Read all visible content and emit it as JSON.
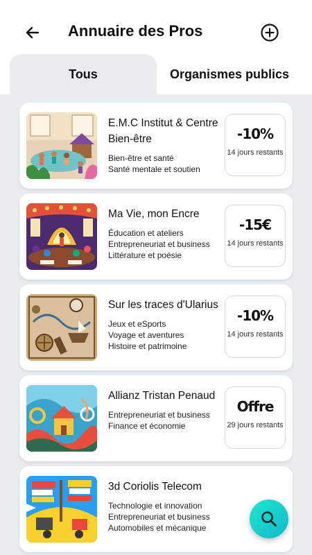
{
  "header": {
    "title": "Annuaire des Pros",
    "back_icon": "arrow-left-icon",
    "add_icon": "plus-circle-icon"
  },
  "tabs": [
    {
      "label": "Tous",
      "selected": true
    },
    {
      "label": "Organismes publics",
      "selected": false
    }
  ],
  "pros": [
    {
      "name": "E.M.C Institut & Centre Bien-être",
      "categories": [
        "Bien-être et santé",
        "Santé mentale et soutien"
      ],
      "offer": "-10%",
      "days": "14 jours restants",
      "thumb_colors": [
        "#6fc3c7",
        "#f2a36b",
        "#7b4aa0"
      ]
    },
    {
      "name": "Ma Vie, mon Encre",
      "categories": [
        "Éducation et ateliers",
        "Entrepreneuriat et business",
        "Littérature et poésie"
      ],
      "offer": "-15€",
      "days": "14 jours restants",
      "thumb_colors": [
        "#f6b93b",
        "#e55039",
        "#6a3093"
      ]
    },
    {
      "name": "Sur les traces d'Ularius",
      "categories": [
        "Jeux et eSports",
        "Voyage et aventures",
        "Histoire et patrimoine"
      ],
      "offer": "-10%",
      "days": "14 jours restants",
      "thumb_colors": [
        "#c8a978",
        "#7a5230",
        "#3b6e8f"
      ]
    },
    {
      "name": "Allianz Tristan Penaud",
      "categories": [
        "Entrepreneuriat et business",
        "Finance et économie"
      ],
      "offer": "Offre",
      "days": "29 jours restants",
      "thumb_colors": [
        "#3aa3c9",
        "#e94e3c",
        "#f4c542"
      ]
    },
    {
      "name": "3d Coriolis Telecom",
      "categories": [
        "Technologie et innovation",
        "Entrepreneuriat et business",
        "Automobiles et mécanique"
      ],
      "offer": "",
      "days": "",
      "thumb_colors": [
        "#2a9df4",
        "#f7d02c",
        "#e8453c"
      ]
    }
  ],
  "fab": {
    "icon": "search-icon"
  },
  "colors": {
    "list_background": "#e8ecef",
    "fab_gradient_start": "#1de7d0",
    "fab_gradient_end": "#12b8c9"
  }
}
